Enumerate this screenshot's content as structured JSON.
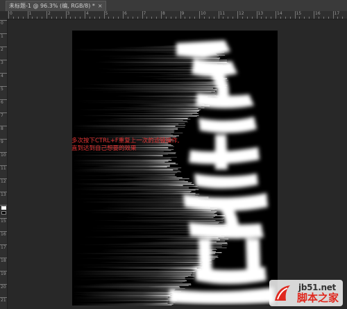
{
  "document_tab": {
    "title": "未标题-1 @ 96.3% (编, RGB/8) *",
    "close_glyph": "×"
  },
  "rulers": {
    "top_labels": [
      "0",
      "1",
      "2",
      "3",
      "4",
      "5",
      "6",
      "7",
      "8",
      "9",
      "10",
      "11",
      "12",
      "13",
      "14",
      "15",
      "16",
      "17"
    ],
    "left_labels": [
      "0",
      "1",
      "2",
      "3",
      "4",
      "5",
      "6",
      "7",
      "8",
      "9",
      "10",
      "11",
      "12",
      "13",
      "14",
      "15",
      "16",
      "17",
      "18",
      "19",
      "20",
      "21"
    ]
  },
  "canvas": {
    "background": "#000000",
    "effect": "wind/motion-blur streaks on white glyph strokes"
  },
  "annotation": {
    "line1": "多次按下CTRL+F重复上一次的滤镜操作,",
    "line2": "直到达到自己想要的效果",
    "color": "#e03232"
  },
  "watermark": {
    "domain": "jb51.net",
    "cn_name": "脚本之家",
    "accent": "#e0281e"
  },
  "colors": {
    "workspace": "#282828",
    "tabbar": "#3a3a3a"
  }
}
